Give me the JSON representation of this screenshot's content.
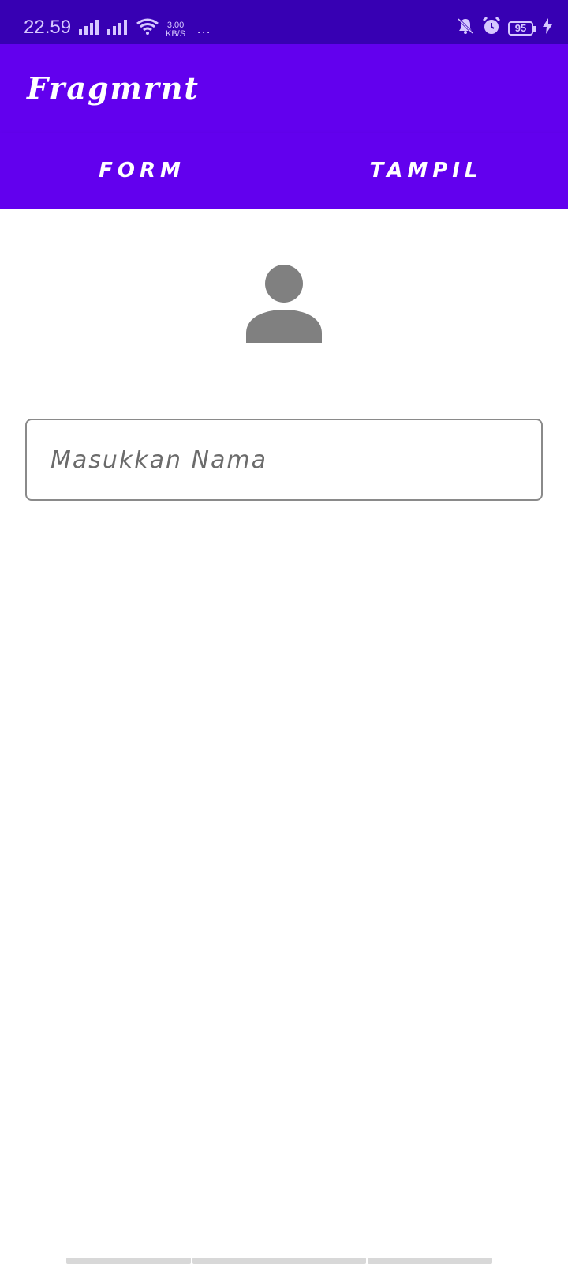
{
  "status_bar": {
    "time": "22.59",
    "net_speed_value": "3.00",
    "net_speed_unit": "KB/S",
    "more": "···",
    "battery_level": "95",
    "icons": [
      "signal-icon",
      "signal-icon",
      "wifi-icon",
      "more-dots-icon",
      "mute-bell-icon",
      "alarm-icon",
      "battery-icon",
      "charging-icon"
    ]
  },
  "app_bar": {
    "title": "Fragmrnt"
  },
  "tabs": [
    {
      "label": "FORM"
    },
    {
      "label": "TAMPIL"
    }
  ],
  "form": {
    "avatar_icon": "person-icon",
    "name_input": {
      "placeholder": "Masukkan Nama",
      "value": ""
    }
  },
  "colors": {
    "status_bar": "#3700b3",
    "primary": "#6200ee",
    "on_primary": "#ffffff",
    "icon_gray": "#808080",
    "field_border": "#8a8a8a"
  }
}
